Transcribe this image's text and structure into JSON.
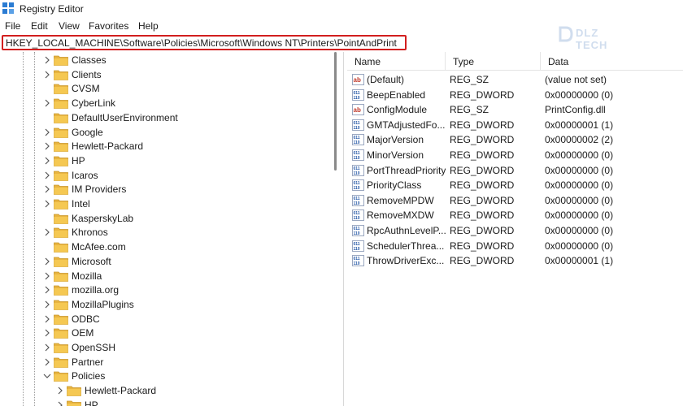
{
  "window": {
    "title": "Registry Editor"
  },
  "menu": [
    "File",
    "Edit",
    "View",
    "Favorites",
    "Help"
  ],
  "address": "HKEY_LOCAL_MACHINE\\Software\\Policies\\Microsoft\\Windows NT\\Printers\\PointAndPrint",
  "watermark": {
    "text": "DLZ TECH"
  },
  "tree": {
    "items": [
      {
        "label": "Classes",
        "chevron": "right"
      },
      {
        "label": "Clients",
        "chevron": "right"
      },
      {
        "label": "CVSM",
        "chevron": "none"
      },
      {
        "label": "CyberLink",
        "chevron": "right"
      },
      {
        "label": "DefaultUserEnvironment",
        "chevron": "none"
      },
      {
        "label": "Google",
        "chevron": "right"
      },
      {
        "label": "Hewlett-Packard",
        "chevron": "right"
      },
      {
        "label": "HP",
        "chevron": "right"
      },
      {
        "label": "Icaros",
        "chevron": "right"
      },
      {
        "label": "IM Providers",
        "chevron": "right"
      },
      {
        "label": "Intel",
        "chevron": "right"
      },
      {
        "label": "KasperskyLab",
        "chevron": "none"
      },
      {
        "label": "Khronos",
        "chevron": "right"
      },
      {
        "label": "McAfee.com",
        "chevron": "none"
      },
      {
        "label": "Microsoft",
        "chevron": "right"
      },
      {
        "label": "Mozilla",
        "chevron": "right"
      },
      {
        "label": "mozilla.org",
        "chevron": "right"
      },
      {
        "label": "MozillaPlugins",
        "chevron": "right"
      },
      {
        "label": "ODBC",
        "chevron": "right"
      },
      {
        "label": "OEM",
        "chevron": "right"
      },
      {
        "label": "OpenSSH",
        "chevron": "right"
      },
      {
        "label": "Partner",
        "chevron": "right"
      },
      {
        "label": "Policies",
        "chevron": "down"
      }
    ],
    "children": [
      {
        "label": "Hewlett-Packard",
        "chevron": "right"
      },
      {
        "label": "HP",
        "chevron": "right"
      }
    ]
  },
  "columns": {
    "name": "Name",
    "type": "Type",
    "data": "Data"
  },
  "values": [
    {
      "name": "(Default)",
      "type": "REG_SZ",
      "data": "(value not set)",
      "icon": "string"
    },
    {
      "name": "BeepEnabled",
      "type": "REG_DWORD",
      "data": "0x00000000 (0)",
      "icon": "dword"
    },
    {
      "name": "ConfigModule",
      "type": "REG_SZ",
      "data": "PrintConfig.dll",
      "icon": "string"
    },
    {
      "name": "GMTAdjustedFo...",
      "type": "REG_DWORD",
      "data": "0x00000001 (1)",
      "icon": "dword"
    },
    {
      "name": "MajorVersion",
      "type": "REG_DWORD",
      "data": "0x00000002 (2)",
      "icon": "dword"
    },
    {
      "name": "MinorVersion",
      "type": "REG_DWORD",
      "data": "0x00000000 (0)",
      "icon": "dword"
    },
    {
      "name": "PortThreadPriority",
      "type": "REG_DWORD",
      "data": "0x00000000 (0)",
      "icon": "dword"
    },
    {
      "name": "PriorityClass",
      "type": "REG_DWORD",
      "data": "0x00000000 (0)",
      "icon": "dword"
    },
    {
      "name": "RemoveMPDW",
      "type": "REG_DWORD",
      "data": "0x00000000 (0)",
      "icon": "dword"
    },
    {
      "name": "RemoveMXDW",
      "type": "REG_DWORD",
      "data": "0x00000000 (0)",
      "icon": "dword"
    },
    {
      "name": "RpcAuthnLevelP...",
      "type": "REG_DWORD",
      "data": "0x00000000 (0)",
      "icon": "dword"
    },
    {
      "name": "SchedulerThrea...",
      "type": "REG_DWORD",
      "data": "0x00000000 (0)",
      "icon": "dword"
    },
    {
      "name": "ThrowDriverExc...",
      "type": "REG_DWORD",
      "data": "0x00000001 (1)",
      "icon": "dword"
    }
  ]
}
